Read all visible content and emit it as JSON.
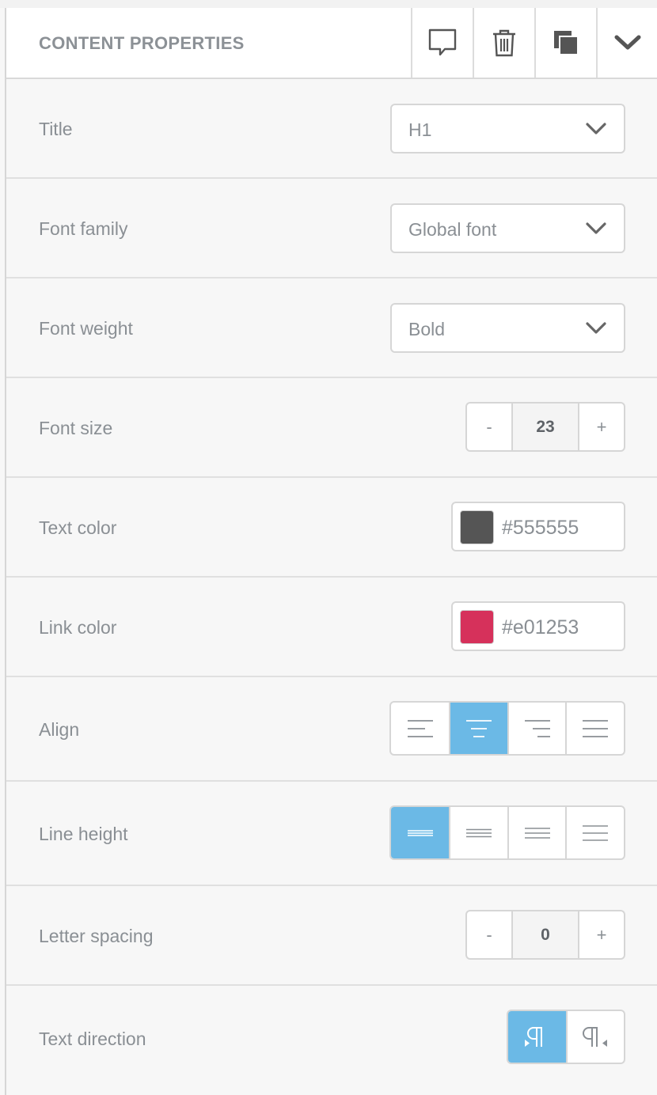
{
  "header": {
    "title": "CONTENT PROPERTIES",
    "buttons": [
      "comment-icon",
      "trash-icon",
      "duplicate-icon",
      "collapse-chevron-icon"
    ]
  },
  "properties": {
    "title": {
      "label": "Title",
      "value": "H1"
    },
    "font_family": {
      "label": "Font family",
      "value": "Global font"
    },
    "font_weight": {
      "label": "Font weight",
      "value": "Bold"
    },
    "font_size": {
      "label": "Font size",
      "value": "23",
      "decrement": "-",
      "increment": "+"
    },
    "text_color": {
      "label": "Text color",
      "value": "#555555",
      "swatch": "#555555"
    },
    "link_color": {
      "label": "Link color",
      "value": "#e01253",
      "swatch": "#d6315b"
    },
    "align": {
      "label": "Align",
      "options": [
        "align-left-icon",
        "align-center-icon",
        "align-right-icon",
        "align-justify-icon"
      ],
      "selected": "align-center-icon"
    },
    "line_height": {
      "label": "Line height",
      "options": [
        "line-height-tight-icon",
        "line-height-normal-icon",
        "line-height-relaxed-icon",
        "line-height-loose-icon"
      ],
      "selected": "line-height-tight-icon"
    },
    "letter_spacing": {
      "label": "Letter spacing",
      "value": "0",
      "decrement": "-",
      "increment": "+"
    },
    "text_direction": {
      "label": "Text direction",
      "options": [
        "ltr-icon",
        "rtl-icon"
      ],
      "selected": "ltr-icon"
    }
  },
  "colors": {
    "accent": "#6bb9e6",
    "border": "#d6d6d6",
    "text": "#8a8f94"
  }
}
